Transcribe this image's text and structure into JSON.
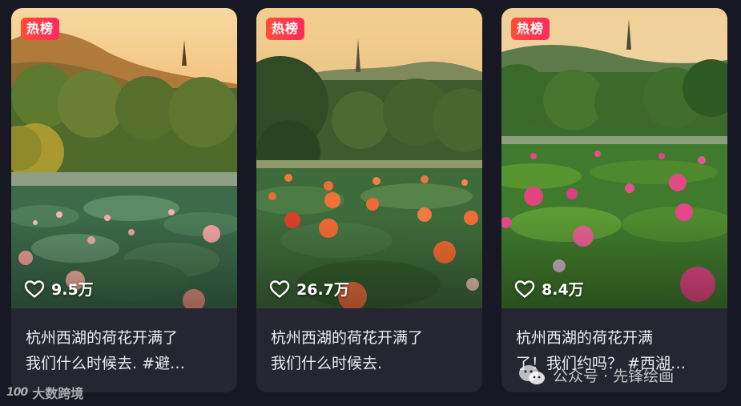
{
  "cards": [
    {
      "badge": "热榜",
      "likes": "9.5万",
      "title_line1": "杭州西湖的荷花开满了",
      "title_line2": "我们什么时候去. #避…"
    },
    {
      "badge": "热榜",
      "likes": "26.7万",
      "title_line1": "杭州西湖的荷花开满了",
      "title_line2": "我们什么时候去."
    },
    {
      "badge": "热榜",
      "likes": "8.4万",
      "title_line1": "杭州西湖的荷花开满",
      "title_line2": "了！我们约吗？ #西湖…"
    }
  ],
  "watermarks": {
    "left_logo": "100",
    "left_text": "大数跨境",
    "right_text": "公众号 · 先锋绘画"
  },
  "colors": {
    "background": "#181824",
    "card": "#262633",
    "badge": "#ff3b4a",
    "title_text": "#ecebf2"
  },
  "icons": [
    "heart-outline-icon",
    "wechat-icon"
  ]
}
